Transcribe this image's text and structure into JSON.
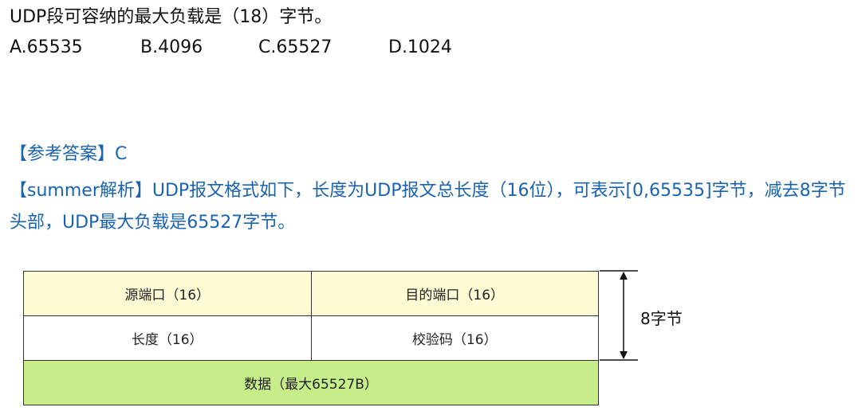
{
  "question": {
    "text": "UDP段可容纳的最大负载是（18）字节。",
    "options": [
      {
        "label": "A.65535"
      },
      {
        "label": "B.4096"
      },
      {
        "label": "C.65527"
      },
      {
        "label": "D.1024"
      }
    ]
  },
  "answer": {
    "text": "【参考答案】C"
  },
  "analysis": {
    "text": "【summer解析】UDP报文格式如下，长度为UDP报文总长度（16位），可表示[0,65535]字节，减去8字节头部，UDP最大负载是65527字节。"
  },
  "diagram": {
    "rows": [
      {
        "cells": [
          "源端口（16）",
          "目的端口（16）"
        ]
      },
      {
        "cells": [
          "长度（16）",
          "校验码（16）"
        ]
      },
      {
        "cells": [
          "数据（最大65527B）"
        ]
      }
    ],
    "header_size_label": "8字节",
    "colors": {
      "header_row": "#fdfbd3",
      "data_row": "#c7ec8a",
      "analysis_text": "#1a63b0"
    }
  }
}
